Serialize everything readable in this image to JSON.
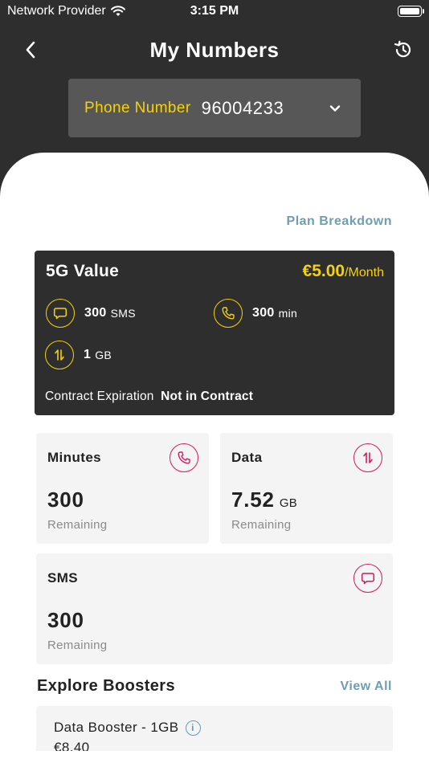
{
  "status_bar": {
    "carrier": "Network Provider",
    "time": "3:15 PM"
  },
  "header": {
    "title": "My Numbers",
    "back_icon": "chevron-left-icon",
    "history_icon": "history-icon"
  },
  "phone_selector": {
    "label": "Phone Number",
    "value": "96004233"
  },
  "plan_breakdown_link": "Plan Breakdown",
  "plan": {
    "name": "5G Value",
    "price": "€5.00",
    "period": "/Month",
    "allowances": [
      {
        "icon": "chat-bubble-icon",
        "value": "300",
        "unit": "SMS"
      },
      {
        "icon": "phone-icon",
        "value": "300",
        "unit": "min"
      },
      {
        "icon": "data-arrows-icon",
        "value": "1",
        "unit": "GB"
      }
    ],
    "contract_label": "Contract Expiration",
    "contract_value": "Not in Contract"
  },
  "usage": {
    "minutes": {
      "title": "Minutes",
      "amount": "300",
      "unit": "",
      "sub": "Remaining",
      "icon": "phone-icon"
    },
    "data": {
      "title": "Data",
      "amount": "7.52",
      "unit": "GB",
      "sub": "Remaining",
      "icon": "data-arrows-icon"
    },
    "sms": {
      "title": "SMS",
      "amount": "300",
      "unit": "",
      "sub": "Remaining",
      "icon": "chat-bubble-icon"
    }
  },
  "boosters": {
    "title": "Explore Boosters",
    "view_all": "View All",
    "items": [
      {
        "name": "Data Booster - 1GB",
        "price": "€8.40"
      }
    ]
  },
  "colors": {
    "background_dark": "#2e2e2e",
    "accent_yellow": "#f5d20b",
    "accent_magenta": "#d11a5e",
    "link_blue": "#6e9eb0",
    "card_grey": "#f4f4f4"
  }
}
